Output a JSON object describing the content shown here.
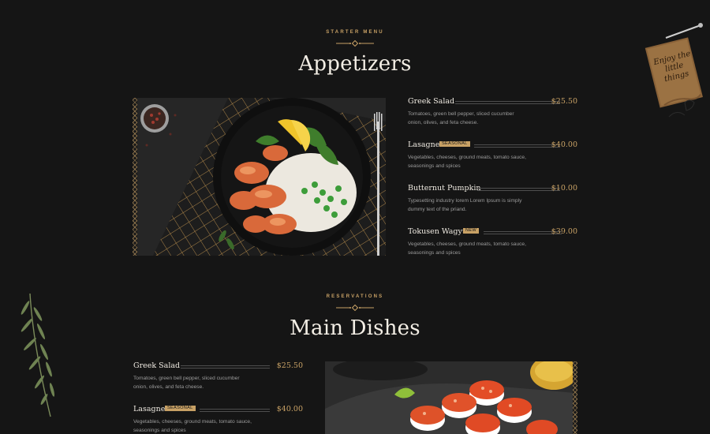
{
  "appetizers": {
    "eyebrow": "STARTER MENU",
    "title": "Appetizers",
    "items": [
      {
        "name": "Greek Salad",
        "badge": "",
        "price": "$25.50",
        "desc": "Tomatoes, green bell pepper, sliced cucumber onion, olives, and feta cheese."
      },
      {
        "name": "Lasagne",
        "badge": "SEASONAL",
        "price": "$40.00",
        "desc": "Vegetables, cheeses, ground meats, tomato sauce, seasonings and spices"
      },
      {
        "name": "Butternut Pumpkin",
        "badge": "",
        "price": "$10.00",
        "desc": "Typesetting industry lorem Lorem Ipsum is simply dummy text of the priand."
      },
      {
        "name": "Tokusen Wagyu",
        "badge": "NEW",
        "price": "$39.00",
        "desc": "Vegetables, cheeses, ground meats, tomato sauce, seasonings and spices"
      }
    ]
  },
  "main_dishes": {
    "eyebrow": "RESERVATIONS",
    "title": "Main Dishes",
    "items": [
      {
        "name": "Greek Salad",
        "badge": "",
        "price": "$25.50",
        "desc": "Tomatoes, green bell pepper, sliced cucumber onion, olives, and feta cheese."
      },
      {
        "name": "Lasagne",
        "badge": "SEASONAL",
        "price": "$40.00",
        "desc": "Vegetables, cheeses, ground meats, tomato sauce, seasonings and spices"
      }
    ]
  },
  "decor": {
    "sign_text": "Enjoy the little things"
  },
  "colors": {
    "background": "#151515",
    "accent_gold": "#c8a165",
    "title": "#f3eee5",
    "muted": "#9c9c9c"
  }
}
